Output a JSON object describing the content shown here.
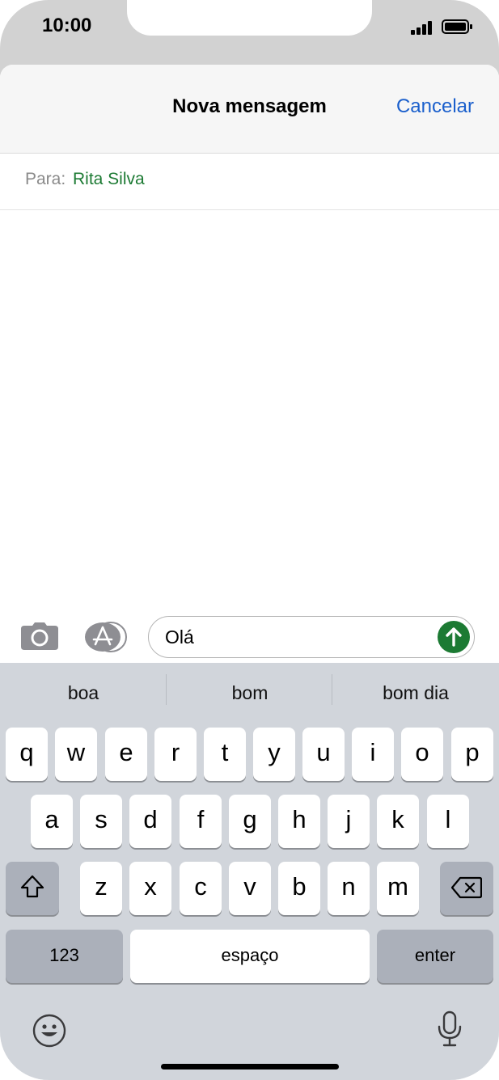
{
  "status": {
    "time": "10:00"
  },
  "header": {
    "title": "Nova mensagem",
    "cancel_label": "Cancelar"
  },
  "recipient": {
    "label": "Para:",
    "name": "Rita Silva"
  },
  "compose": {
    "text": "Olá"
  },
  "suggestions": [
    "boa",
    "bom",
    "bom dia"
  ],
  "keyboard": {
    "row1": [
      "q",
      "w",
      "e",
      "r",
      "t",
      "y",
      "u",
      "i",
      "o",
      "p"
    ],
    "row2": [
      "a",
      "s",
      "d",
      "f",
      "g",
      "h",
      "j",
      "k",
      "l"
    ],
    "row3": [
      "z",
      "x",
      "c",
      "v",
      "b",
      "n",
      "m"
    ],
    "numbers_label": "123",
    "space_label": "espaço",
    "enter_label": "enter"
  },
  "colors": {
    "accent_blue": "#1a5fcc",
    "accent_green": "#1c7a33",
    "keyboard_bg": "#d1d5db"
  },
  "icons": [
    "camera-icon",
    "app-store-icon",
    "send-arrow-icon",
    "shift-icon",
    "delete-icon",
    "emoji-icon",
    "microphone-icon"
  ]
}
